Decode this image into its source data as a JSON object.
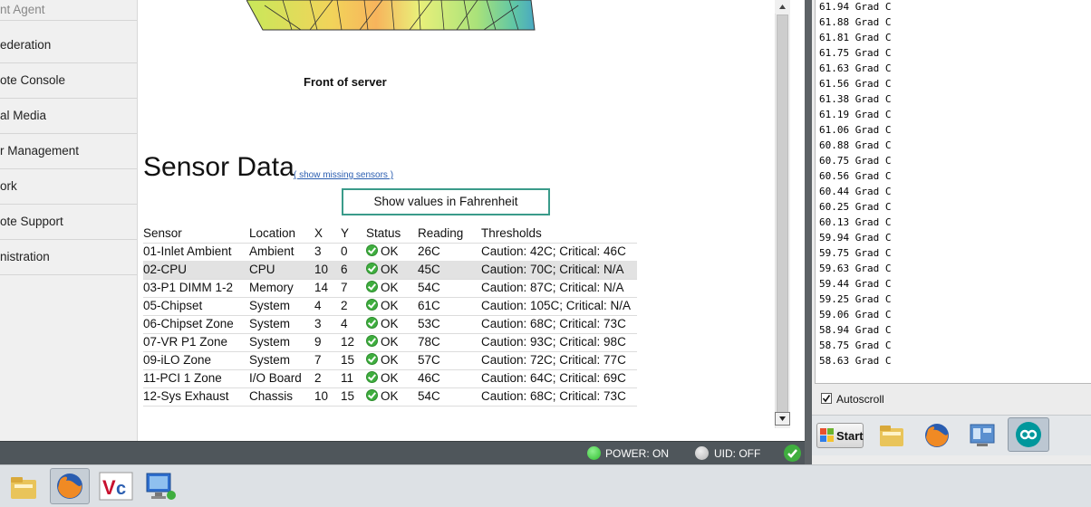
{
  "sidebar": {
    "items": [
      {
        "label": "nt Agent"
      },
      {
        "label": "ederation"
      },
      {
        "label": "ote Console"
      },
      {
        "label": "al Media"
      },
      {
        "label": "r Management"
      },
      {
        "label": "ork"
      },
      {
        "label": "ote Support"
      },
      {
        "label": "nistration"
      }
    ]
  },
  "main": {
    "figure_caption": "Front of server",
    "section_title": "Sensor Data",
    "show_missing_link": "( show missing sensors )",
    "fahrenheit_button": "Show values in Fahrenheit",
    "table": {
      "headers": [
        "Sensor",
        "Location",
        "X",
        "Y",
        "Status",
        "Reading",
        "Thresholds"
      ],
      "rows": [
        [
          "01-Inlet Ambient",
          "Ambient",
          "3",
          "0",
          "OK",
          "26C",
          "Caution: 42C; Critical: 46C"
        ],
        [
          "02-CPU",
          "CPU",
          "10",
          "6",
          "OK",
          "45C",
          "Caution: 70C; Critical: N/A"
        ],
        [
          "03-P1 DIMM 1-2",
          "Memory",
          "14",
          "7",
          "OK",
          "54C",
          "Caution: 87C; Critical: N/A"
        ],
        [
          "05-Chipset",
          "System",
          "4",
          "2",
          "OK",
          "61C",
          "Caution: 105C; Critical: N/A"
        ],
        [
          "06-Chipset Zone",
          "System",
          "3",
          "4",
          "OK",
          "53C",
          "Caution: 68C; Critical: 73C"
        ],
        [
          "07-VR P1 Zone",
          "System",
          "9",
          "12",
          "OK",
          "78C",
          "Caution: 93C; Critical: 98C"
        ],
        [
          "09-iLO Zone",
          "System",
          "7",
          "15",
          "OK",
          "57C",
          "Caution: 72C; Critical: 77C"
        ],
        [
          "11-PCI 1 Zone",
          "I/O Board",
          "2",
          "11",
          "OK",
          "46C",
          "Caution: 64C; Critical: 69C"
        ],
        [
          "12-Sys Exhaust",
          "Chassis",
          "10",
          "15",
          "OK",
          "54C",
          "Caution: 68C; Critical: 73C"
        ]
      ],
      "highlighted_row": 1
    }
  },
  "statusbar": {
    "power": "POWER: ON",
    "uid": "UID: OFF",
    "power_color": "#2fbf2f",
    "uid_color": "#b5b5b5"
  },
  "serial": {
    "lines": [
      "61.94 Grad C",
      "61.88 Grad C",
      "61.81 Grad C",
      "61.75 Grad C",
      "61.63 Grad C",
      "61.56 Grad C",
      "61.38 Grad C",
      "61.19 Grad C",
      "61.06 Grad C",
      "60.88 Grad C",
      "60.75 Grad C",
      "60.56 Grad C",
      "60.44 Grad C",
      "60.25 Grad C",
      "60.13 Grad C",
      "59.94 Grad C",
      "59.75 Grad C",
      "59.63 Grad C",
      "59.44 Grad C",
      "59.25 Grad C",
      "59.06 Grad C",
      "58.94 Grad C",
      "58.75 Grad C",
      "58.63 Grad C"
    ],
    "autoscroll_label": "Autoscroll",
    "autoscroll_checked": true,
    "start_label": "Start"
  },
  "icons": {
    "folder": "folder-icon",
    "firefox": "firefox-icon",
    "vnc": "vnc-icon",
    "remote": "remote-desktop-icon",
    "arduino": "arduino-icon"
  }
}
